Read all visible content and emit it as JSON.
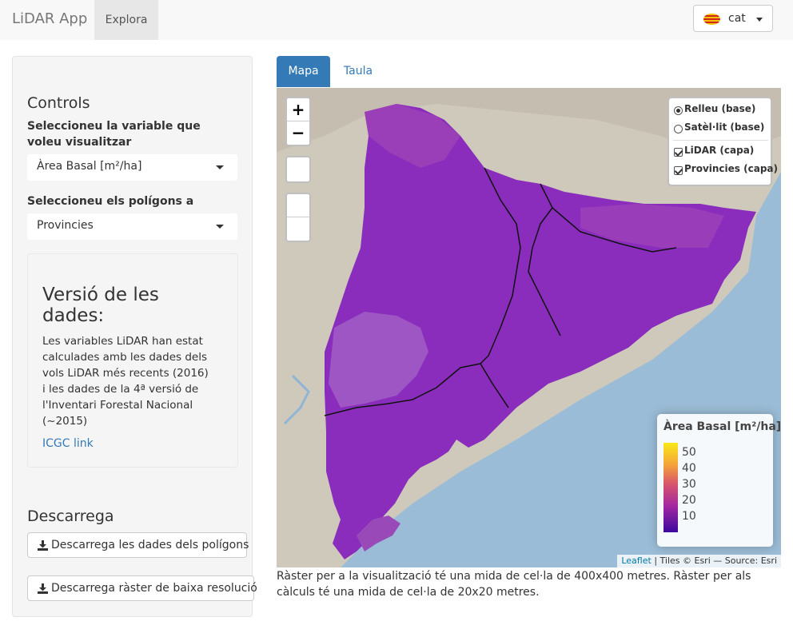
{
  "navbar": {
    "brand": "LiDAR App",
    "tab": "Explora",
    "language": "cat"
  },
  "sidebar": {
    "controls_title": "Controls",
    "variable_label": "Seleccioneu la variable que voleu visualitzar",
    "variable_value": "Àrea Basal [m²/ha]",
    "polygons_label": "Seleccioneu els polígons a agregar",
    "polygons_value": "Provincies",
    "version_title": "Versió de les dades:",
    "version_text": "Les variables LiDAR han estat calculades amb les dades dels vols LiDAR més recents (2016) i les dades de la 4ª versió de l'Inventari Forestal Nacional (~2015)",
    "version_link": "ICGC link",
    "download_title": "Descarrega",
    "download_polygons": "Descarrega les dades dels polígons",
    "download_raster": "Descarrega ràster de baixa resolució"
  },
  "main": {
    "tabs": [
      {
        "label": "Mapa",
        "active": true
      },
      {
        "label": "Taula",
        "active": false
      }
    ],
    "caption": "Ràster per a la visualització té una mida de cel·la de 400x400 metres. Ràster per als càlculs té una mida de cel·la de 20x20 metres."
  },
  "map": {
    "zoom_in": "+",
    "zoom_out": "−",
    "layers": {
      "base": [
        {
          "label": "Relleu (base)",
          "selected": true
        },
        {
          "label": "Satèl·lit (base)",
          "selected": false
        }
      ],
      "overlays": [
        {
          "label": "LiDAR (capa)",
          "checked": true
        },
        {
          "label": "Provincies (capa)",
          "checked": true
        }
      ]
    },
    "legend": {
      "title": "Àrea Basal [m²/ha]",
      "ticks": [
        "50",
        "40",
        "30",
        "20",
        "10"
      ],
      "colors": [
        "#f8e81a",
        "#f4a23a",
        "#d9576a",
        "#a528a0",
        "#3b089e"
      ]
    },
    "attribution": {
      "link": "Leaflet",
      "rest": "| Tiles © Esri — Source: Esri"
    },
    "colors": {
      "sea": "#9bbcd6",
      "land": "#cfc9bc",
      "region": "#8a2dbd",
      "region_light": "#a360c5"
    }
  }
}
